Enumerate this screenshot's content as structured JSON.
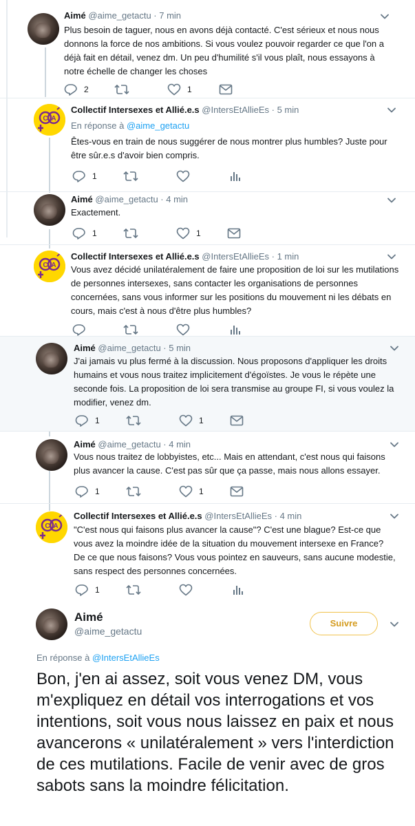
{
  "tweets": [
    {
      "name": "Aimé",
      "handle": "@aime_getactu",
      "time": "· 7 min",
      "text": "Plus besoin de taguer, nous en avons déjà contacté. C'est sérieux et nous nous donnons la force de nos ambitions. Si vous voulez pouvoir regarder ce que l'on a déjà fait en détail, venez dm. Un peu d'humilité s'il vous plaît, nous essayons à notre échelle de changer les choses",
      "replies": "2",
      "retweets": "",
      "likes": "1"
    },
    {
      "name": "Collectif Intersexes et Allié.e.s",
      "handle": "@IntersEtAllieEs",
      "time": "· 5 min",
      "reply_label": "En réponse à",
      "reply_handle": "@aime_getactu",
      "text": "Êtes-vous en train de nous suggérer de nous montrer plus humbles? Juste pour être sûr.e.s d'avoir bien compris.",
      "replies": "1",
      "retweets": "",
      "likes": ""
    },
    {
      "name": "Aimé",
      "handle": "@aime_getactu",
      "time": "· 4 min",
      "text": "Exactement.",
      "replies": "1",
      "retweets": "",
      "likes": "1"
    },
    {
      "name": "Collectif Intersexes et Allié.e.s",
      "handle": "@IntersEtAllieEs",
      "time": "· 1 min",
      "text": "Vous avez décidé unilatéralement de faire une proposition de loi sur les mutilations de personnes intersexes, sans contacter les organisations de personnes concernées, sans vous informer sur les positions du mouvement ni les débats en cours, mais c'est à nous d'être plus humbles?",
      "replies": "",
      "retweets": "",
      "likes": ""
    },
    {
      "name": "Aimé",
      "handle": "@aime_getactu",
      "time": "· 5 min",
      "text": "J'ai jamais vu plus fermé à la discussion. Nous proposons d'appliquer les droits humains et vous nous traitez implicitement d'égoïstes. Je vous le répète une seconde fois. La proposition de loi sera transmise au groupe FI, si vous voulez la modifier, venez dm.",
      "replies": "1",
      "retweets": "",
      "likes": "1"
    },
    {
      "name": "Aimé",
      "handle": "@aime_getactu",
      "time": "· 4 min",
      "text": "Vous nous traitez de lobbyistes, etc... Mais en attendant, c'est nous qui faisons plus avancer la cause. C'est pas sûr que ça passe, mais nous allons essayer.",
      "replies": "1",
      "retweets": "",
      "likes": "1"
    },
    {
      "name": "Collectif Intersexes et Allié.e.s",
      "handle": "@IntersEtAllieEs",
      "time": "· 4 min",
      "text": "\"C'est nous qui faisons plus avancer la cause\"? C'est une blague? Est-ce que vous avez la moindre idée de la situation du mouvement intersexe en France? De ce que nous faisons? Vous vous pointez en sauveurs, sans aucune modestie, sans respect des personnes concernées.",
      "replies": "1",
      "retweets": "",
      "likes": ""
    }
  ],
  "main_tweet": {
    "name": "Aimé",
    "handle": "@aime_getactu",
    "follow_label": "Suivre",
    "reply_label": "En réponse à",
    "reply_handle": "@IntersEtAllieEs",
    "text": "Bon, j'en ai assez, soit vous venez DM, vous m'expliquez en détail vos interrogations et vos intentions, soit vous nous laissez en paix et nous avancerons « unilatéralement » vers l'interdiction de ces mutilations. Facile de venir avec de gros sabots sans la moindre félicitation."
  },
  "colors": {
    "link": "#1da1f2",
    "secondary_text": "#657786",
    "follow_border": "#f0c24b",
    "follow_text": "#d49b1e",
    "collectif_avatar_bg": "#ffd700",
    "collectif_symbol": "#7b2a8e"
  }
}
